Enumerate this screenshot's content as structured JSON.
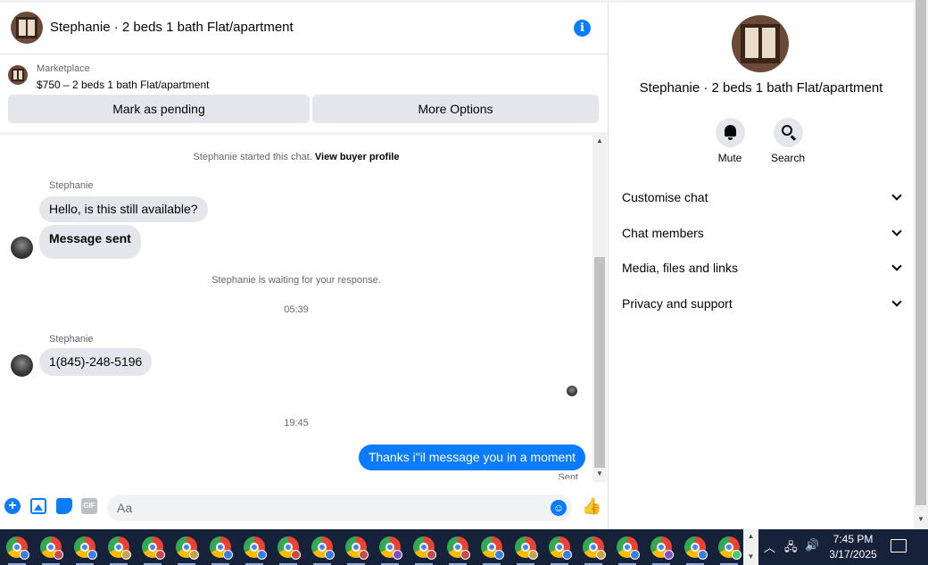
{
  "chat": {
    "title": "Stephanie · 2 beds 1 bath Flat/apartment",
    "marketplace_label": "Marketplace",
    "listing": "$750 – 2 beds 1 bath Flat/apartment",
    "mark_pending": "Mark as pending",
    "more_options": "More Options"
  },
  "messages": {
    "started_prefix": "Stephanie started this chat.",
    "started_link": "View buyer profile",
    "sender1": "Stephanie",
    "msg1": "Hello, is this still available?",
    "msg2": "Message sent",
    "waiting": "Stephanie is waiting for your response.",
    "time1": "05:39",
    "sender2": "Stephanie",
    "msg3": "1(845)-248-5196",
    "time2": "19:45",
    "msg4": "Thanks i\"il message you in a moment",
    "status": "Sent"
  },
  "composer": {
    "placeholder": "Aa",
    "gif": "GIF"
  },
  "panel": {
    "title": "Stephanie · 2 beds 1 bath Flat/apartment",
    "mute": "Mute",
    "search": "Search",
    "items": [
      "Customise chat",
      "Chat members",
      "Media, files and links",
      "Privacy and support"
    ]
  },
  "taskbar": {
    "time": "7:45 PM",
    "date": "3/17/2025",
    "badge_colors": [
      "#3b7de0",
      "#c94a4a",
      "#3b7de0",
      "#c9a24a",
      "#c94a4a",
      "#c9a24a",
      "#3b7de0",
      "#3b7de0",
      "#c94a4a",
      "#3b7de0",
      "#c94a4a",
      "#8a4ac9",
      "#c94a4a",
      "#c94a4a",
      "#3b7de0",
      "#c9a24a",
      "#3b7de0",
      "#c9a24a",
      "#3b7de0",
      "#8a4ac9",
      "#3b7de0",
      "#4ac96a"
    ]
  }
}
